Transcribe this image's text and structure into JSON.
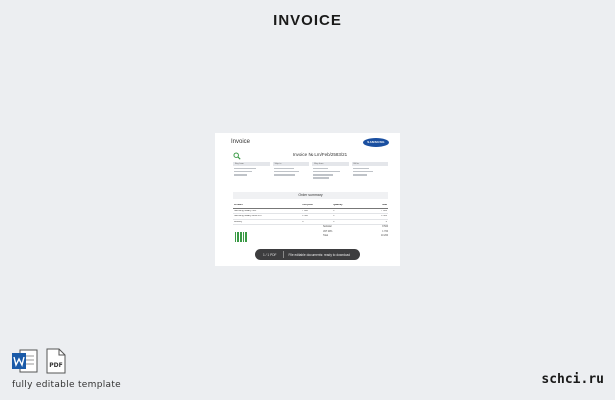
{
  "page": {
    "title": "INVOICE"
  },
  "document": {
    "header_label": "Invoice",
    "brand_logo": "SAMSUNG",
    "invoice_title": "Invoice № Lm/Feb/2583/21",
    "summary_label": "Order summary",
    "parties": [
      "Buy from",
      "Ship to",
      "Ship from",
      "Bill to"
    ],
    "table_header": [
      "Product",
      "Unit price",
      "Quantity",
      "Total"
    ],
    "table_rows": [
      [
        "Samsung Galaxy S21",
        "7 000",
        "1",
        "7 000"
      ],
      [
        "Samsung Galaxy Buds Pro",
        "1 500",
        "1",
        "1 500"
      ],
      [
        "Delivery",
        "0",
        "1",
        "0"
      ]
    ],
    "totals": [
      [
        "Subtotal",
        "8 500"
      ],
      [
        "VAT 20%",
        "1 700"
      ],
      [
        "Total",
        "10 200"
      ]
    ]
  },
  "download_bar": {
    "left_text": "1 / 1 PDF",
    "right_text": "File editable documents: ready to download"
  },
  "footer": {
    "formats": [
      "word-icon",
      "pdf-icon"
    ],
    "pdf_label": "PDF",
    "note": "fully editable template",
    "site": "schci.ru"
  },
  "colors": {
    "background": "#eceef1",
    "word": "#1a5aa8",
    "brand": "#1a4fa0",
    "barcode": "#3a9a45"
  }
}
